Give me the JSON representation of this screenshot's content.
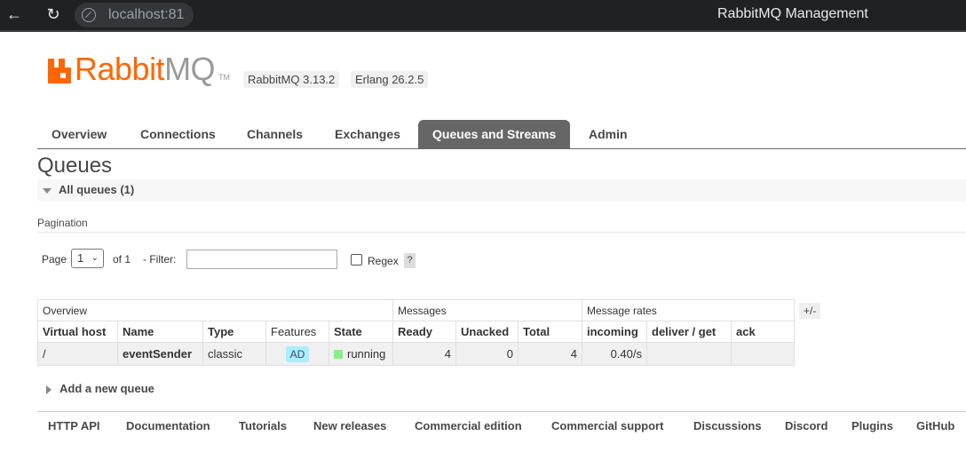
{
  "browser": {
    "url": "localhost:81",
    "window_title": "RabbitMQ Management"
  },
  "header": {
    "logo_rabbit": "Rabbit",
    "logo_mq": "MQ",
    "logo_tm": "TM",
    "rabbitmq_version": "RabbitMQ 3.13.2",
    "erlang_version": "Erlang 26.2.5"
  },
  "tabs": [
    {
      "label": "Overview"
    },
    {
      "label": "Connections"
    },
    {
      "label": "Channels"
    },
    {
      "label": "Exchanges"
    },
    {
      "label": "Queues and Streams",
      "active": true
    },
    {
      "label": "Admin"
    }
  ],
  "page": {
    "title": "Queues",
    "section_label": "All queues (1)",
    "pagination_label": "Pagination"
  },
  "controls": {
    "page_label": "Page",
    "page_value": "1",
    "of_label": "of 1",
    "filter_label": "- Filter:",
    "filter_value": "",
    "regex_label": "Regex",
    "help_label": "?"
  },
  "table": {
    "groups": {
      "overview": "Overview",
      "messages": "Messages",
      "message_rates": "Message rates"
    },
    "columns": [
      "Virtual host",
      "Name",
      "Type",
      "Features",
      "State",
      "Ready",
      "Unacked",
      "Total",
      "incoming",
      "deliver / get",
      "ack"
    ],
    "rows": [
      {
        "virtual_host": "/",
        "name": "eventSender",
        "type": "classic",
        "features": "AD",
        "state": "running",
        "ready": "4",
        "unacked": "0",
        "total": "4",
        "incoming": "0.40/s",
        "deliver_get": "",
        "ack": ""
      }
    ],
    "columns_toggle": "+/-"
  },
  "add_queue_label": "Add a new queue",
  "footer": {
    "links": [
      "HTTP API",
      "Documentation",
      "Tutorials",
      "New releases",
      "Commercial edition",
      "Commercial support",
      "Discussions",
      "Discord",
      "Plugins",
      "GitHub"
    ]
  },
  "colors": {
    "brand_orange": "#ff6600",
    "tab_active_bg": "#666666",
    "features_badge": "#aaeeff",
    "state_running": "#88ee88"
  }
}
